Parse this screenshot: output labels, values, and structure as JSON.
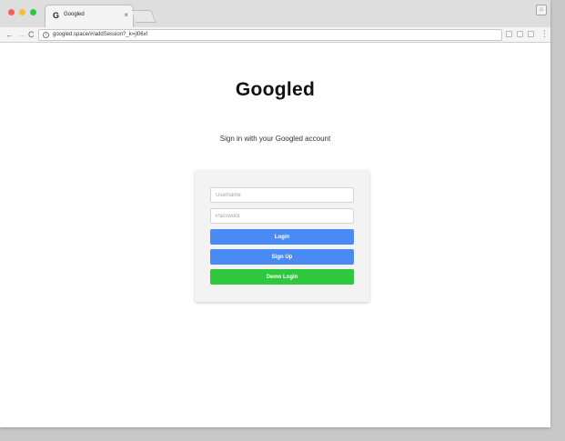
{
  "browser": {
    "tab_title": "Googled",
    "tab_favicon": "G",
    "tab_close": "×",
    "url": "googled.space/#/addSession?_k=jl06xl",
    "nav": {
      "back": "←",
      "forward": "→",
      "reload": "C"
    },
    "menu": "⋮",
    "profile_glyph": "⌂"
  },
  "page": {
    "logo": "Googled",
    "subtitle": "Sign in with your Googled account",
    "form": {
      "username_placeholder": "Username",
      "password_placeholder": "Password",
      "login_label": "Login",
      "signup_label": "Sign Up",
      "demo_label": "Demo Login"
    }
  },
  "colors": {
    "primary_button": "#4a8af4",
    "demo_button": "#2ec73d",
    "background": "#c8c8c8"
  }
}
